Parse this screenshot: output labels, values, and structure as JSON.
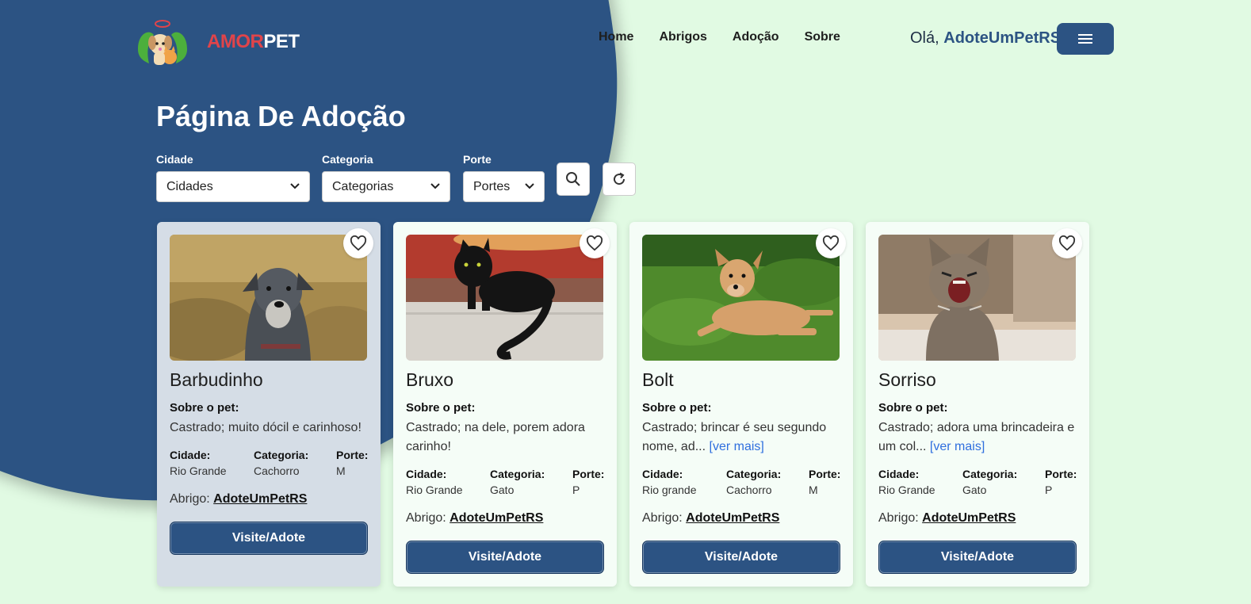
{
  "header": {
    "brand_part1": "AMOR",
    "brand_part2": "PET",
    "nav": [
      "Home",
      "Abrigos",
      "Adoção",
      "Sobre"
    ],
    "greeting": "Olá,",
    "username": "AdoteUmPetRS"
  },
  "page": {
    "title": "Página De Adoção"
  },
  "filters": {
    "city_label": "Cidade",
    "city_value": "Cidades",
    "category_label": "Categoria",
    "category_value": "Categorias",
    "size_label": "Porte",
    "size_value": "Portes"
  },
  "labels": {
    "about": "Sobre o pet:",
    "city": "Cidade:",
    "category": "Categoria:",
    "size": "Porte:",
    "shelter": "Abrigo:",
    "adopt_button": "Visite/Adote",
    "see_more": "[ver mais]"
  },
  "pets": [
    {
      "name": "Barbudinho",
      "about": "Castrado; muito dócil e carinhoso!",
      "city": "Rio Grande",
      "category": "Cachorro",
      "size": "M",
      "shelter": "AdoteUmPetRS"
    },
    {
      "name": "Bruxo",
      "about": "Castrado; na dele, porem adora carinho!",
      "city": "Rio Grande",
      "category": "Gato",
      "size": "P",
      "shelter": "AdoteUmPetRS"
    },
    {
      "name": "Bolt",
      "about": "Castrado; brincar é seu segundo nome, ad...",
      "city": "Rio grande",
      "category": "Cachorro",
      "size": "M",
      "shelter": "AdoteUmPetRS"
    },
    {
      "name": "Sorriso",
      "about": "Castrado; adora uma brincadeira e um col...",
      "city": "Rio Grande",
      "category": "Gato",
      "size": "P",
      "shelter": "AdoteUmPetRS"
    }
  ],
  "colors": {
    "primary": "#2c5383",
    "background": "#e1fae3",
    "brand_red": "#e0444a",
    "link_blue": "#2f6fde"
  },
  "icons": [
    "menu-icon",
    "search-icon",
    "refresh-icon",
    "heart-icon"
  ]
}
